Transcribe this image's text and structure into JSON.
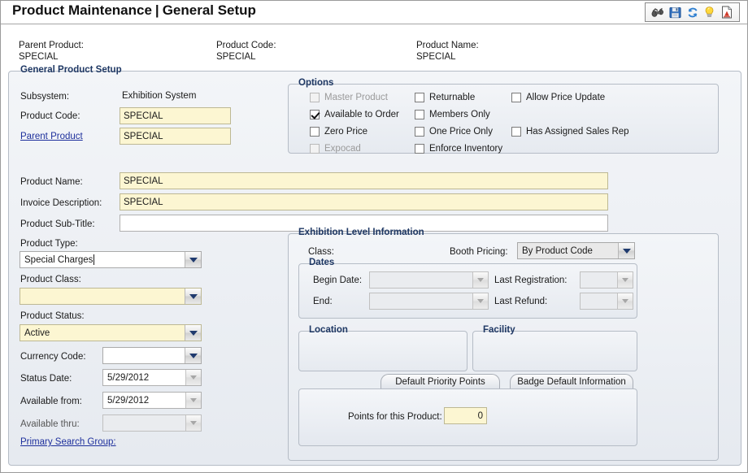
{
  "window": {
    "title_main": "Product Maintenance",
    "title_sep": "|",
    "title_sub": "General Setup"
  },
  "toolbar": {
    "items": [
      {
        "name": "binoculars-icon",
        "label": "Find"
      },
      {
        "name": "save-icon",
        "label": "Save"
      },
      {
        "name": "refresh-icon",
        "label": "Refresh"
      },
      {
        "name": "lightbulb-icon",
        "label": "Hint"
      },
      {
        "name": "report-icon",
        "label": "Report"
      }
    ]
  },
  "header": {
    "parent_product_label": "Parent Product:",
    "parent_product_value": "SPECIAL",
    "product_code_label": "Product Code:",
    "product_code_value": "SPECIAL",
    "product_name_label": "Product Name:",
    "product_name_value": "SPECIAL"
  },
  "general": {
    "legend": "General Product Setup",
    "subsystem_label": "Subsystem:",
    "subsystem_value": "Exhibition System",
    "product_code_label": "Product Code:",
    "product_code_value": "SPECIAL",
    "parent_product_link": "Parent Product",
    "parent_product_value": "SPECIAL",
    "product_name_label": "Product Name:",
    "product_name_value": "SPECIAL",
    "invoice_description_label": "Invoice Description:",
    "invoice_description_value": "SPECIAL",
    "product_subtitle_label": "Product Sub-Title:",
    "product_subtitle_value": "",
    "product_type_label": "Product Type:",
    "product_type_value": "Special Charges",
    "product_class_label": "Product Class:",
    "product_class_value": "",
    "product_status_label": "Product Status:",
    "product_status_value": "Active",
    "currency_code_label": "Currency Code:",
    "currency_code_value": "",
    "status_date_label": "Status Date:",
    "status_date_value": "5/29/2012",
    "available_from_label": "Available from:",
    "available_from_value": "5/29/2012",
    "available_thru_label": "Available thru:",
    "available_thru_value": "",
    "primary_search_group_link": "Primary Search Group:"
  },
  "options": {
    "legend": "Options",
    "col1": [
      {
        "label": "Master Product",
        "checked": false,
        "disabled": true
      },
      {
        "label": "Available to Order",
        "checked": true,
        "disabled": false
      },
      {
        "label": "Zero Price",
        "checked": false,
        "disabled": false
      },
      {
        "label": "Expocad",
        "checked": false,
        "disabled": true
      }
    ],
    "col2": [
      {
        "label": "Returnable",
        "checked": false,
        "disabled": false
      },
      {
        "label": "Members Only",
        "checked": false,
        "disabled": false
      },
      {
        "label": "One Price Only",
        "checked": false,
        "disabled": false
      },
      {
        "label": "Enforce Inventory",
        "checked": false,
        "disabled": false
      }
    ],
    "col3": [
      {
        "label": "Allow Price Update",
        "checked": false,
        "disabled": false
      },
      {
        "label": "Has Assigned Sales Rep",
        "checked": false,
        "disabled": false
      }
    ]
  },
  "exhibition": {
    "legend": "Exhibition Level Information",
    "class_label": "Class:",
    "class_value": "",
    "booth_pricing_label": "Booth Pricing:",
    "booth_pricing_value": "By Product Code",
    "dates_legend": "Dates",
    "begin_date_label": "Begin Date:",
    "begin_date_value": "",
    "end_label": "End:",
    "end_value": "",
    "last_registration_label": "Last Registration:",
    "last_registration_value": "",
    "last_refund_label": "Last Refund:",
    "last_refund_value": "",
    "location_legend": "Location",
    "facility_legend": "Facility",
    "tab_priority_points": "Default Priority Points",
    "tab_badge_default": "Badge Default Information",
    "points_label": "Points for this Product:",
    "points_value": "0"
  },
  "colors": {
    "accent": "#1f3864",
    "field_yellow": "#fcf6d2",
    "link": "#1d2f9c",
    "panel": "#e6eaf0"
  }
}
